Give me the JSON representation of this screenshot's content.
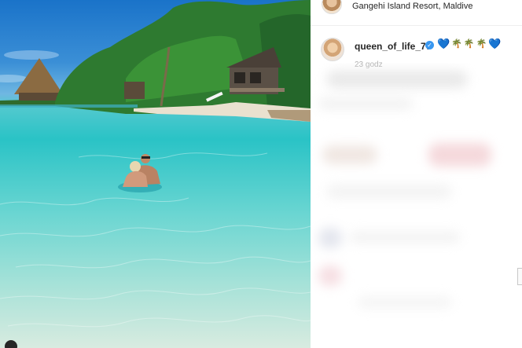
{
  "post": {
    "location": "Gangehi Island Resort, Maldive",
    "username": "queen_of_life_77",
    "caption_emojis": [
      {
        "glyph": "💙",
        "kind": "heart"
      },
      {
        "glyph": "🌴",
        "kind": "palm"
      },
      {
        "glyph": "🌴",
        "kind": "palm"
      },
      {
        "glyph": "🌴",
        "kind": "palm"
      },
      {
        "glyph": "💙",
        "kind": "heart"
      }
    ],
    "timestamp": "23 godz",
    "verified_icon": "✓"
  },
  "colors": {
    "verified": "#3897f0",
    "water": "#2ac3c6",
    "sky": "#1a73c9"
  }
}
